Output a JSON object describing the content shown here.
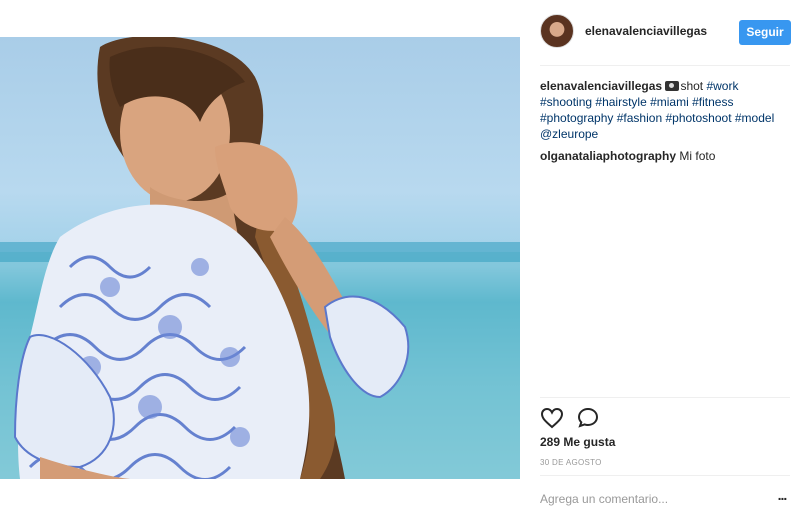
{
  "post": {
    "author": "elenavalenciavillegas",
    "follow_label": "Seguir"
  },
  "caption": {
    "user": "elenavalenciavillegas",
    "camera_icon": "camera-emoji",
    "text_before": "shot ",
    "tags": [
      "#work",
      "#shooting",
      "#hairstyle",
      "#miami",
      "#fitness",
      "#photography",
      "#fashion",
      "#photoshoot",
      "#model",
      "@zleurope"
    ]
  },
  "comment": {
    "user": "olganataliaphotography",
    "text": "Mi foto"
  },
  "actions": {
    "like_icon": "heart-icon",
    "comment_icon": "comment-bubble-icon"
  },
  "likes_text": "289 Me gusta",
  "date_text": "30 DE AGOSTO",
  "comment_box": {
    "placeholder": "Agrega un comentario...",
    "more_label": "..."
  },
  "colors": {
    "accent": "#3897f0",
    "hashtag": "#003569",
    "muted": "#999999"
  }
}
